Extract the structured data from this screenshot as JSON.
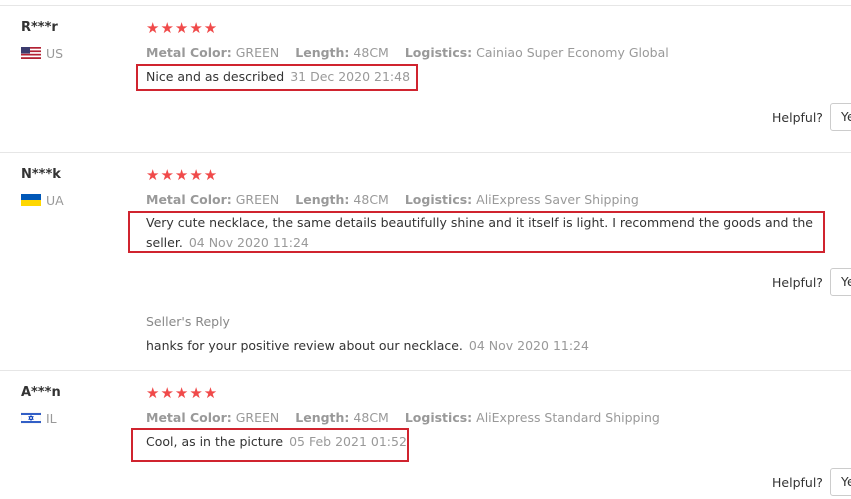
{
  "reviews": [
    {
      "user": "R***r",
      "country": "US",
      "flag_icon": "us-flag-icon",
      "rating": "★★★★★",
      "attributes": [
        {
          "key": "Metal Color:",
          "value": "GREEN"
        },
        {
          "key": "Length:",
          "value": "48CM"
        },
        {
          "key": "Logistics:",
          "value": "Cainiao Super Economy Global"
        }
      ],
      "text": "Nice and as described",
      "date": "31 Dec 2020 21:48",
      "helpful_label": "Helpful?",
      "helpful_button": "Yes"
    },
    {
      "user": "N***k",
      "country": "UA",
      "flag_icon": "ua-flag-icon",
      "rating": "★★★★★",
      "attributes": [
        {
          "key": "Metal Color:",
          "value": "GREEN"
        },
        {
          "key": "Length:",
          "value": "48CM"
        },
        {
          "key": "Logistics:",
          "value": "AliExpress Saver Shipping"
        }
      ],
      "text": "Very cute necklace, the same details beautifully shine and it itself is light. I recommend the goods and the seller.",
      "date": "04 Nov 2020 11:24",
      "helpful_label": "Helpful?",
      "helpful_button": "Yes",
      "seller_reply": {
        "title": "Seller's Reply",
        "text": "hanks for your positive review about our necklace.",
        "date": "04 Nov 2020 11:24"
      }
    },
    {
      "user": "A***n",
      "country": "IL",
      "flag_icon": "il-flag-icon",
      "rating": "★★★★★",
      "attributes": [
        {
          "key": "Metal Color:",
          "value": "GREEN"
        },
        {
          "key": "Length:",
          "value": "48CM"
        },
        {
          "key": "Logistics:",
          "value": "AliExpress Standard Shipping"
        }
      ],
      "text": "Cool, as in the picture",
      "date": "05 Feb 2021 01:52",
      "helpful_label": "Helpful?",
      "helpful_button": "Yes"
    }
  ],
  "colors": {
    "star": "#f04a4a",
    "highlight_border": "#d0242f",
    "muted_text": "#999999"
  }
}
